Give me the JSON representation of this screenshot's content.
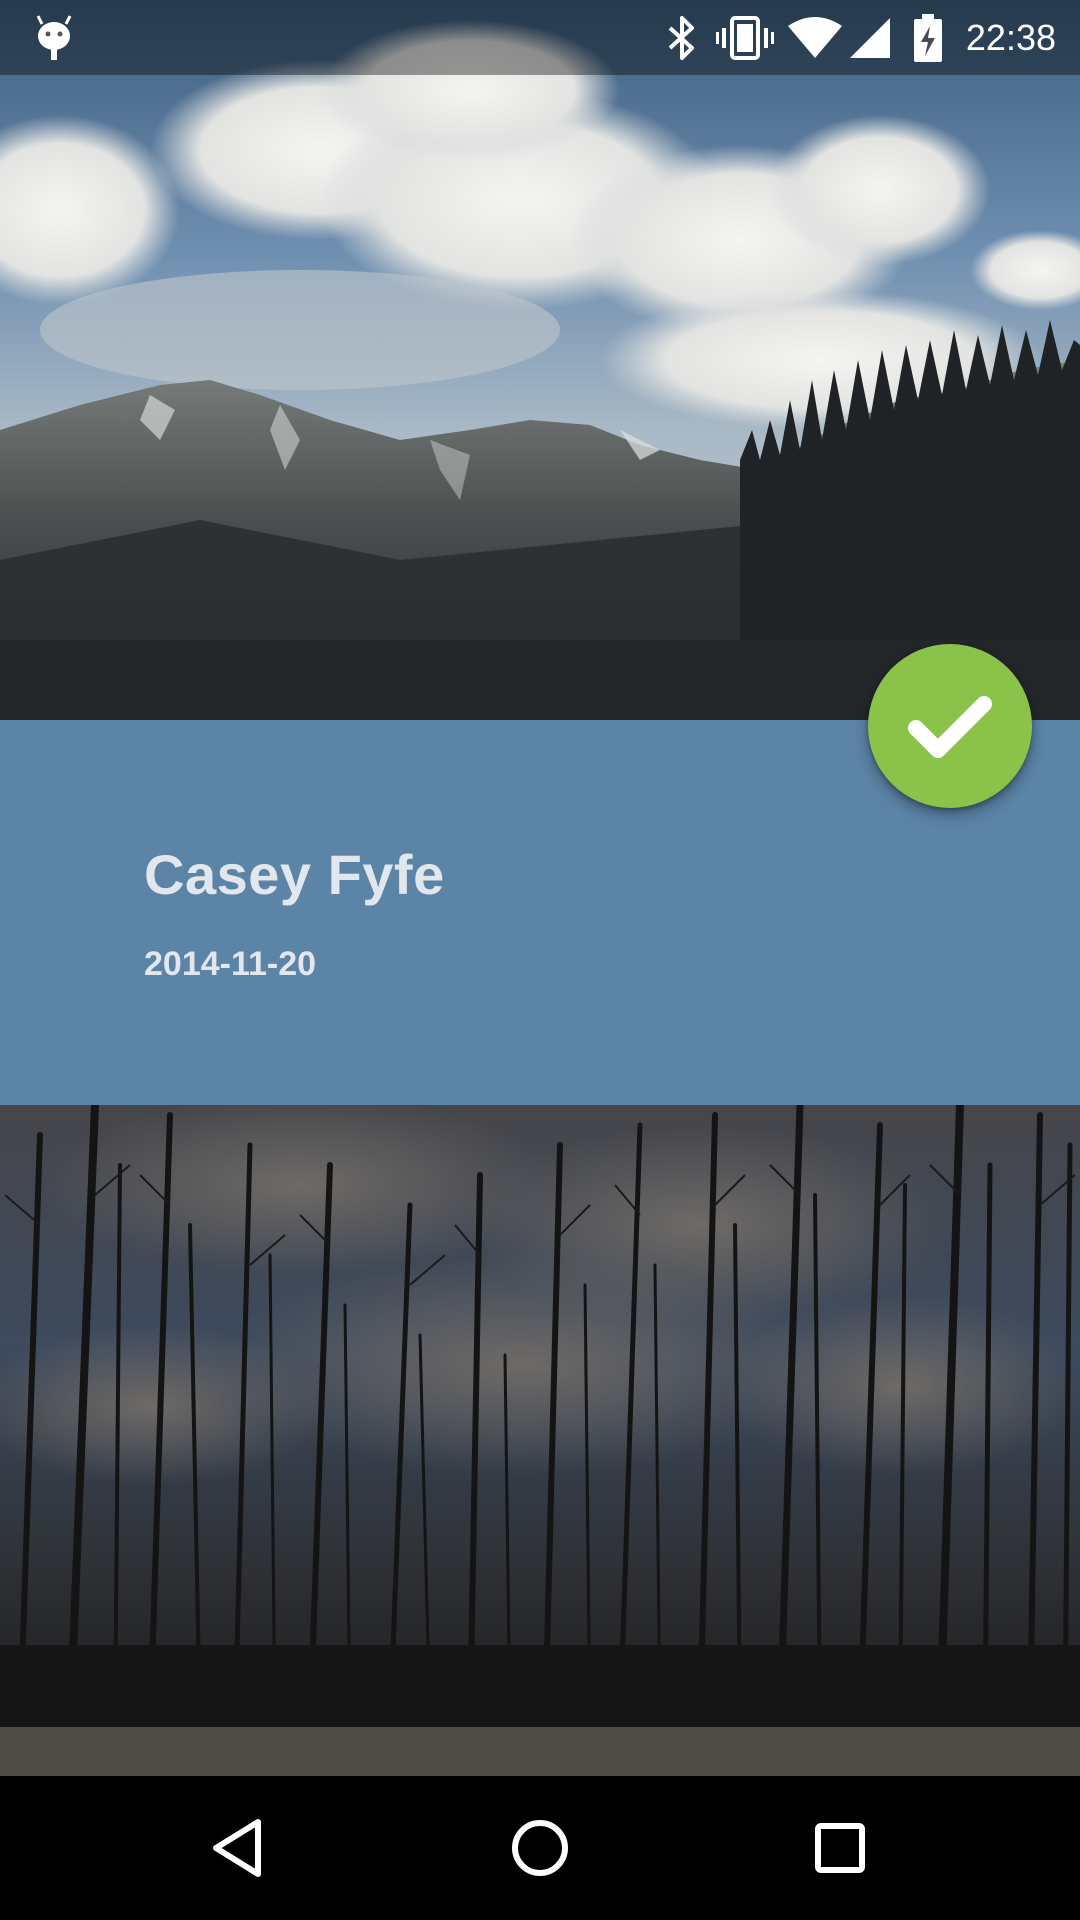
{
  "status_bar": {
    "time": "22:38",
    "icons": [
      "android-debug-icon",
      "bluetooth-icon",
      "vibrate-icon",
      "wifi-icon",
      "cell-signal-icon",
      "battery-charging-icon"
    ]
  },
  "detail": {
    "name": "Casey Fyfe",
    "date": "2014-11-20"
  },
  "fab": {
    "icon": "check-icon",
    "color": "#8bc34a"
  },
  "colors": {
    "panel": "#5b84a7",
    "fab": "#8bc34a",
    "nav_bar": "#000000"
  },
  "nav_bar": {
    "buttons": [
      "back-icon",
      "home-icon",
      "recents-icon"
    ]
  }
}
